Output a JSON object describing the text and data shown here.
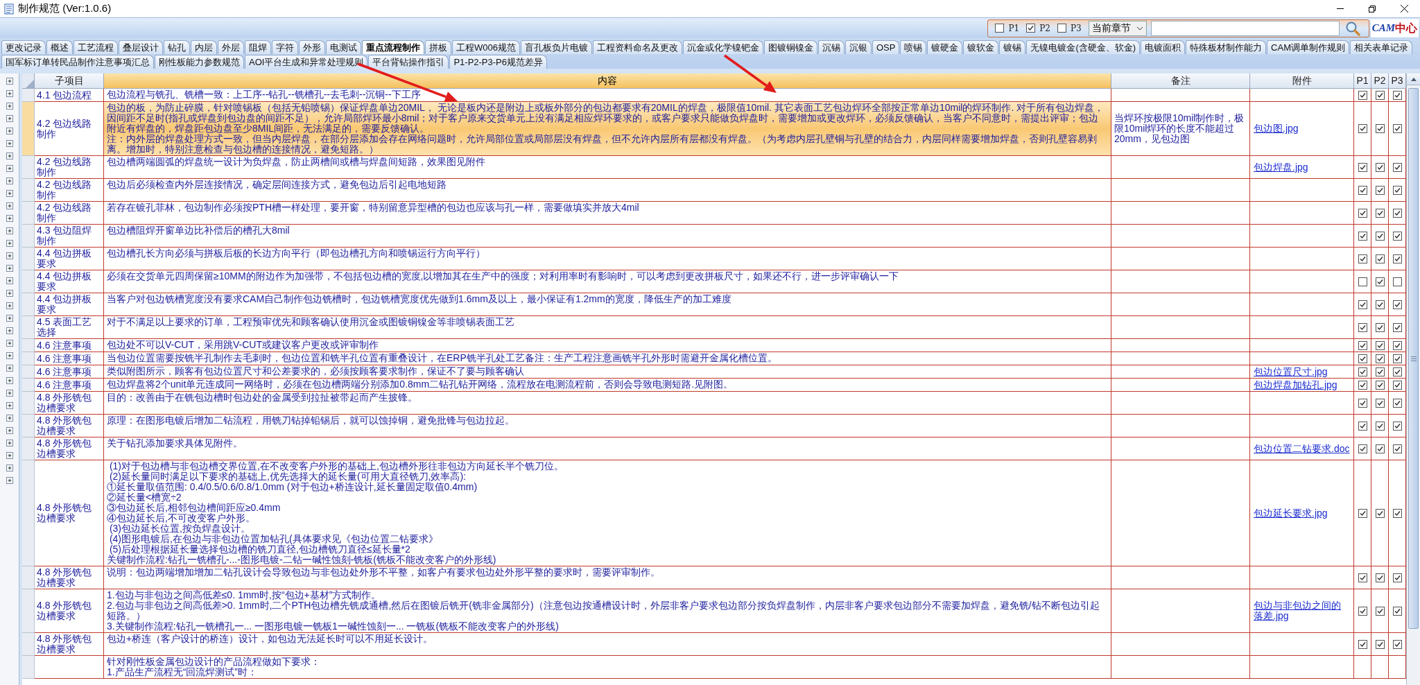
{
  "window": {
    "title": "制作规范 (Ver:1.0.6)"
  },
  "filter": {
    "checkboxes": [
      {
        "label": "P1",
        "checked": false
      },
      {
        "label": "P2",
        "checked": true
      },
      {
        "label": "P3",
        "checked": false
      }
    ],
    "scope": {
      "value": "当前章节"
    },
    "logo": {
      "prefix": "CAM",
      "suffix": "中心"
    }
  },
  "tab_rows": [
    [
      {
        "label": "更改记录",
        "selected": false
      },
      {
        "label": "概述",
        "selected": false
      },
      {
        "label": "工艺流程",
        "selected": false
      },
      {
        "label": "叠层设计",
        "selected": false
      },
      {
        "label": "钻孔",
        "selected": false
      },
      {
        "label": "内层",
        "selected": false
      },
      {
        "label": "外层",
        "selected": false
      },
      {
        "label": "阻焊",
        "selected": false
      },
      {
        "label": "字符",
        "selected": false
      },
      {
        "label": "外形",
        "selected": false
      },
      {
        "label": "电测试",
        "selected": false
      },
      {
        "label": "重点流程制作",
        "selected": true
      },
      {
        "label": "拼板",
        "selected": false
      },
      {
        "label": "工程W006规范",
        "selected": false
      },
      {
        "label": "盲孔板负片电镀",
        "selected": false
      },
      {
        "label": "工程资料命名及更改",
        "selected": false
      },
      {
        "label": "沉金或化学镍钯金",
        "selected": false
      },
      {
        "label": "图镀铜镍金",
        "selected": false
      },
      {
        "label": "沉锡",
        "selected": false
      },
      {
        "label": "沉银",
        "selected": false
      },
      {
        "label": "OSP",
        "selected": false
      },
      {
        "label": "喷锡",
        "selected": false
      },
      {
        "label": "镀硬金",
        "selected": false
      },
      {
        "label": "镀软金",
        "selected": false
      },
      {
        "label": "镀锡",
        "selected": false
      },
      {
        "label": "无镍电镀金(含硬金、软金)",
        "selected": false
      },
      {
        "label": "电镀面积",
        "selected": false
      },
      {
        "label": "特殊板材制作能力",
        "selected": false
      },
      {
        "label": "CAM调单制作规则",
        "selected": false
      },
      {
        "label": "相关表单记录",
        "selected": false
      }
    ],
    [
      {
        "label": "国军标订单转民品制作注意事项汇总",
        "selected": false
      },
      {
        "label": "刚性板能力参数规范",
        "selected": false
      },
      {
        "label": "AOI平台生成和异常处理规则",
        "selected": false
      },
      {
        "label": "平台背钻操作指引",
        "selected": false
      },
      {
        "label": "P1-P2-P3-P6规范差异",
        "selected": false
      }
    ]
  ],
  "tree_gutter": [
    {
      "expanded": false
    },
    {
      "expanded": false
    },
    {
      "expanded": false
    },
    {
      "expanded": false
    },
    {
      "expanded": false
    },
    {
      "expanded": false
    },
    {
      "expanded": false
    },
    {
      "expanded": false
    },
    {
      "expanded": false
    },
    {
      "expanded": false
    },
    {
      "expanded": false
    },
    {
      "expanded": false
    },
    {
      "expanded": false
    },
    {
      "expanded": false
    },
    {
      "expanded": false
    },
    {
      "expanded": false
    },
    {
      "expanded": false
    },
    {
      "expanded": false
    },
    {
      "expanded": false
    },
    {
      "expanded": false
    },
    {
      "expanded": false
    },
    {
      "expanded": false
    },
    {
      "expanded": false
    },
    {
      "expanded": false
    },
    {
      "expanded": false
    },
    {
      "expanded": false
    },
    {
      "expanded": false
    },
    {
      "expanded": false
    },
    {
      "expanded": false
    },
    {
      "expanded": false
    },
    {
      "expanded": false
    },
    {
      "expanded": false
    },
    {
      "expanded": false
    }
  ],
  "table": {
    "columns": [
      {
        "label": "子项目",
        "selected": false
      },
      {
        "label": "内容",
        "selected": true
      },
      {
        "label": "备注",
        "selected": false
      },
      {
        "label": "附件",
        "selected": false
      },
      {
        "label": "P1",
        "selected": false
      },
      {
        "label": "P2",
        "selected": false
      },
      {
        "label": "P3",
        "selected": false
      }
    ],
    "rows": [
      {
        "section": "4.1 包边流程",
        "content": "包边流程与铣孔、铣槽一致：上工序--钻孔--铣槽孔--去毛刺--沉铜--下工序",
        "selected": false,
        "p1": true,
        "p2": true,
        "p3": true
      },
      {
        "section": "4.2 包边线路制作",
        "content": [
          "包边的板，为防止碎膜，针对喷锡板（包括无铅喷锡）保证焊盘单边20MIL， 无论是板内还是附边上或板外部分的包边都要求有20MIL的焊盘，极限值10mil. 其它表面工艺包边焊环全部按正常单边10mil的焊环制作. 对于所有包边焊盘，因间距不足时(指孔或焊盘到包边盘的间距不足），允许局部焊环最小8mil；对于客户原来交货单元上没有满足相应焊环要求的，或客户要求只能做负焊盘时，需要增加或更改焊环，必须反馈确认，当客户不同意时，需提出评审；包边附近有焊盘的，焊盘距包边盘至少8MIL间距，无法满足的，需要反馈确认。",
          "注：内外层的焊盘处理方式一致，但当内层焊盘，在部分层添加会存在网络问题时，允许局部位置或局部层没有焊盘，但不允许内层所有层都没有焊盘。（为考虑内层孔壁铜与孔壁的结合力，内层同样需要增加焊盘，否则孔壁容易剥离。增加时，特别注意检查与包边槽的连接情况，避免短路。）"
        ],
        "note": "当焊环按极限10mil制作时，极限10mil焊环的长度不能超过20mm，见包边图",
        "attachment": "包边图.jpg",
        "selected": true,
        "p1": true,
        "p2": true,
        "p3": true
      },
      {
        "section": "4.2 包边线路制作",
        "content": "包边槽两端圆弧的焊盘统一设计为负焊盘，防止两槽间或槽与焊盘间短路，效果图见附件",
        "attachment": "包边焊盘.jpg",
        "selected": false,
        "p1": true,
        "p2": true,
        "p3": true
      },
      {
        "section": "4.2 包边线路制作",
        "content": "包边后必须检查内外层连接情况，确定层间连接方式，避免包边后引起电地短路",
        "selected": false,
        "p1": true,
        "p2": true,
        "p3": true
      },
      {
        "section": "4.2 包边线路制作",
        "content": "若存在镀孔菲林，包边制作必须按PTH槽一样处理，要开窗，特别留意异型槽的包边也应该与孔一样，需要做填实并放大4mil",
        "selected": false,
        "p1": true,
        "p2": true,
        "p3": true
      },
      {
        "section": "4.3 包边阻焊制作",
        "content": "包边槽阻焊开窗单边比补偿后的槽孔大8mil",
        "selected": false,
        "p1": true,
        "p2": true,
        "p3": true
      },
      {
        "section": "4.4 包边拼板要求",
        "content": "包边槽孔长方向必须与拼板后板的长边方向平行（即包边槽孔方向和喷锡运行方向平行）",
        "selected": false,
        "p1": true,
        "p2": true,
        "p3": true
      },
      {
        "section": "4.4 包边拼板要求",
        "content": "必须在交货单元四周保留≥10MM的附边作为加强带，不包括包边槽的宽度,以增加其在生产中的强度；对利用率时有影响时，可以考虑到更改拼板尺寸，如果还不行，进一步评审确认一下",
        "selected": false,
        "p1": false,
        "p2": true,
        "p3": false
      },
      {
        "section": "4.4 包边拼板要求",
        "content": "当客户对包边铣槽宽度没有要求CAM自己制作包边铣槽时，包边铣槽宽度优先做到1.6mm及以上，最小保证有1.2mm的宽度，降低生产的加工难度",
        "selected": false,
        "p1": true,
        "p2": true,
        "p3": true
      },
      {
        "section": "4.5 表面工艺选择",
        "content": "对于不满足以上要求的订单，工程预审优先和顾客确认使用沉金或图镀铜镍金等非喷锡表面工艺",
        "selected": false,
        "p1": true,
        "p2": true,
        "p3": true
      },
      {
        "section": "4.6 注意事项",
        "content": "包边处不可以V-CUT，采用跳V-CUT或建议客户更改或评审制作",
        "selected": false,
        "p1": true,
        "p2": true,
        "p3": true
      },
      {
        "section": "4.6 注意事项",
        "content": "当包边位置需要按铣半孔制作去毛刺时，包边位置和铣半孔位置有重叠设计，在ERP铣半孔处工艺备注：生产工程注意画铣半孔外形时需避开金属化槽位置。",
        "selected": false,
        "p1": true,
        "p2": true,
        "p3": true
      },
      {
        "section": "4.6 注意事项",
        "content": "类似附图所示，顾客有包边位置尺寸和公差要求的，必须按顾客要求制作，保证不了要与顾客确认",
        "attachment": "包边位置尺寸.jpg",
        "selected": false,
        "p1": true,
        "p2": true,
        "p3": true
      },
      {
        "section": "4.6 注意事项",
        "content": "包边焊盘将2个unit单元连成同一网络时，必须在包边槽两端分别添加0.8mm二钻孔钻开网络，流程放在电测流程前，否则会导致电测短路.见附图。",
        "attachment": "包边焊盘加钻孔.jpg",
        "selected": false,
        "p1": true,
        "p2": true,
        "p3": true
      },
      {
        "section": "4.8 外形铣包边槽要求",
        "content": "目的：改善由于在铣包边槽时包边处的金属受到拉扯被带起而产生披锋。",
        "selected": false,
        "p1": true,
        "p2": true,
        "p3": true
      },
      {
        "section": "4.8 外形铣包边槽要求",
        "content": "原理：在图形电镀后增加二钻流程，用铣刀钻掉铅锡后，就可以蚀掉铜，避免批锋与包边拉起。",
        "selected": false,
        "p1": true,
        "p2": true,
        "p3": true
      },
      {
        "section": "4.8 外形铣包边槽要求",
        "content": "关于钻孔添加要求具体见附件。",
        "attachment": "包边位置二钻要求.doc",
        "selected": false,
        "p1": true,
        "p2": true,
        "p3": true
      },
      {
        "section": "4.8 外形铣包边槽要求",
        "content": [
          " (1)对于包边槽与非包边槽交界位置,在不改变客户外形的基础上,包边槽外形往非包边方向延长半个铣刀位。",
          " (2)延长量同时满足以下要求的基础上,优先选择大的延长量(可用大直径铣刀,效率高):",
          "①延长量取值范围: 0.4/0.5/0.6/0.8/1.0mm (对于包边+桥连设计,延长量固定取值0.4mm)",
          "②延长量<槽宽÷2",
          "③包边延长后,相邻包边槽间距应≥0.4mm",
          "④包边延长后,不可改变客户外形。",
          " (3)包边延长位置,按负焊盘设计。",
          " (4)图形电镀后,在包边与非包边位置加钻孔(具体要求见《包边位置二钻要求》",
          " (5)后处理根据延长量选择包边槽的铣刀直径,包边槽铣刀直径≤延长量*2",
          "关键制作流程:钻孔一铣槽孔-...-图形电镀-二钻一碱性蚀刻-铣板(铣板不能改变客户的外形线)"
        ],
        "attachment": "包边延长要求.jpg",
        "selected": false,
        "p1": true,
        "p2": true,
        "p3": true
      },
      {
        "section": "4.8 外形铣包边槽要求",
        "content": "说明：包边两端增加增加二钻孔设计会导致包边与非包边处外形不平整，如客户有要求包边处外形平整的要求时，需要评审制作。",
        "selected": false,
        "p1": true,
        "p2": true,
        "p3": true
      },
      {
        "section": "4.8 外形铣包边槽要求",
        "content": [
          "1.包边与非包边之间高低差≤0. 1mm时,按“包边+基材”方式制作。",
          "2.包边与非包边之间高低差>0. 1mm时,二个PTH包边槽先铣成通槽,然后在图镀后铣开(铣非金属部分)（注意包边按通槽设计时，外层非客户要求包边部分按负焊盘制作，内层非客户要求包边部分不需要加焊盘，避免铣/钻不断包边引起短路。）",
          "3.关键制作流程:钻孔一铣槽孔一... 一图形电镀一铣板1一碱性蚀刻一... 一铣板(铣板不能改变客户的外形线)"
        ],
        "attachment": "包边与非包边之间的落差.jpg",
        "selected": false,
        "p1": true,
        "p2": true,
        "p3": true
      },
      {
        "section": "4.8 外形铣包边槽要求",
        "content": "包边+桥连（客户设计的桥连）设计，如包边无法延长时可以不用延长设计。",
        "selected": false,
        "p1": true,
        "p2": true,
        "p3": true
      },
      {
        "content": [
          "针对刚性板金属包边设计的产品流程做如下要求：",
          "1.产品生产流程无“回流焊测试”时："
        ],
        "selected": false
      }
    ]
  }
}
